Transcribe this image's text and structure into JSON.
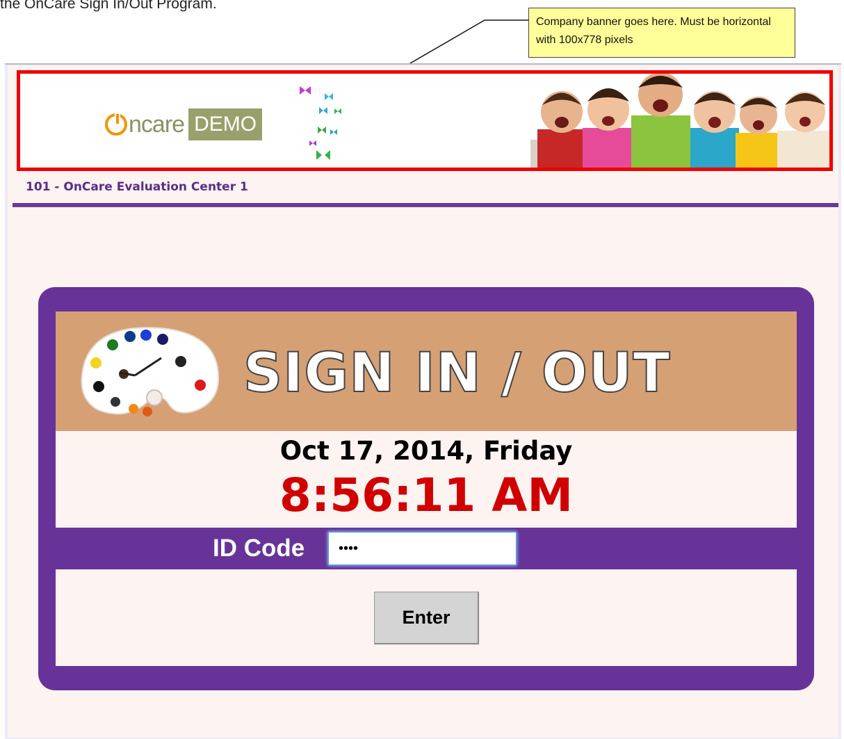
{
  "document": {
    "intro_text": "the OnCare Sign In/Out Program."
  },
  "callout": {
    "text": "Company banner goes here. Must be horizontal with 100x778 pixels",
    "background": "#ffff99"
  },
  "banner": {
    "border_color": "#ee0000",
    "logo_word": "ncare",
    "logo_badge": "DEMO",
    "logo_icon": "power-icon",
    "decoration": "butterflies-icon",
    "photo": "children-photo"
  },
  "center": {
    "name": "101 - OnCare Evaluation Center 1",
    "accent": "#6a3a98"
  },
  "signin": {
    "title": "SIGN IN / OUT",
    "header_art": "paint-palette-clock-icon",
    "date": "Oct 17, 2014, Friday",
    "time": "8:56:11 AM",
    "time_color": "#d00000",
    "panel_color": "#673399",
    "header_color": "#d6a075",
    "id_label": "ID Code",
    "id_value": "••••",
    "enter_label": "Enter"
  }
}
